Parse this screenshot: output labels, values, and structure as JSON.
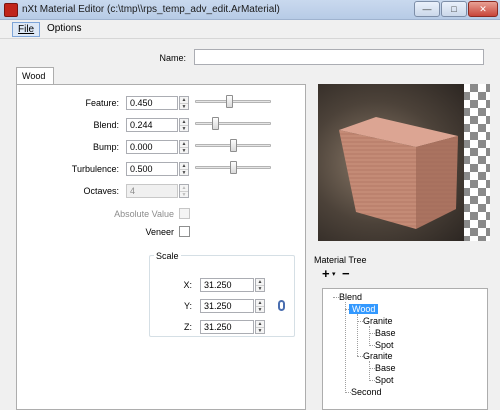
{
  "window": {
    "title": "nXt Material Editor (c:\\tmp\\\\rps_temp_adv_edit.ArMaterial)",
    "buttons": {
      "minimize": "—",
      "maximize": "□",
      "close": "✕"
    }
  },
  "menu": {
    "file": "File",
    "options": "Options"
  },
  "name_field": {
    "label": "Name:",
    "value": ""
  },
  "tab": {
    "label": "Wood"
  },
  "properties": {
    "feature": {
      "label": "Feature:",
      "value": "0.450",
      "slider": 0.45
    },
    "blend": {
      "label": "Blend:",
      "value": "0.244",
      "slider": 0.244
    },
    "bump": {
      "label": "Bump:",
      "value": "0.000",
      "slider": 0.5
    },
    "turbulence": {
      "label": "Turbulence:",
      "value": "0.500",
      "slider": 0.5
    },
    "octaves": {
      "label": "Octaves:",
      "value": "4"
    }
  },
  "checks": {
    "absolute": {
      "label": "Absolute Value",
      "checked": false,
      "enabled": false
    },
    "veneer": {
      "label": "Veneer",
      "checked": false,
      "enabled": true
    }
  },
  "scale": {
    "title": "Scale",
    "x": {
      "label": "X:",
      "value": "31.250"
    },
    "y": {
      "label": "Y:",
      "value": "31.250"
    },
    "z": {
      "label": "Z:",
      "value": "31.250"
    }
  },
  "material_tree": {
    "title": "Material Tree",
    "toolbar": {
      "add": "+",
      "dropdown": "▾",
      "remove": "−"
    },
    "nodes": {
      "blend": "Blend",
      "wood": "Wood",
      "granite1": "Granite",
      "base1": "Base",
      "spot1": "Spot",
      "granite2": "Granite",
      "base2": "Base",
      "spot2": "Spot",
      "second": "Second"
    }
  },
  "colors": {
    "accent": "#3399ff",
    "cube_face": "#c98e7a",
    "titlebar": "#c9d9ee"
  }
}
